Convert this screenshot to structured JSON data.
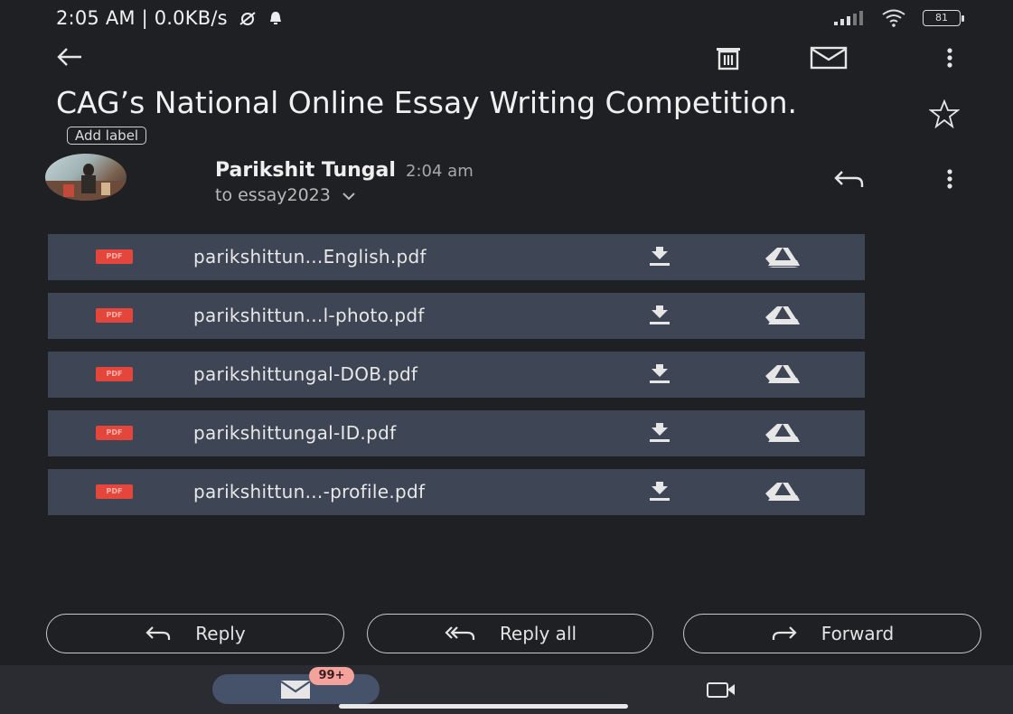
{
  "status_bar": {
    "left_text": "2:05 AM | 0.0KB/s",
    "battery": "81"
  },
  "email": {
    "subject": "CAG’s National Online Essay Writing Competition.",
    "add_label": "Add label",
    "sender": "Parikshit Tungal",
    "time": "2:04 am",
    "recipient": "to essay2023",
    "attachments": [
      {
        "name": "parikshittun...English.pdf",
        "badge": "PDF"
      },
      {
        "name": "parikshittun...l-photo.pdf",
        "badge": "PDF"
      },
      {
        "name": "parikshittungal-DOB.pdf",
        "badge": "PDF"
      },
      {
        "name": "parikshittungal-ID.pdf",
        "badge": "PDF"
      },
      {
        "name": "parikshittun...-profile.pdf",
        "badge": "PDF"
      }
    ]
  },
  "actions": {
    "reply": "Reply",
    "reply_all": "Reply all",
    "forward": "Forward"
  },
  "bottom_nav": {
    "mail_badge": "99+"
  },
  "icons": {
    "back": "back-arrow-icon",
    "delete": "trash-icon",
    "mark_unread": "envelope-icon",
    "more": "more-vert-icon",
    "star": "star-icon",
    "reply": "reply-icon",
    "download": "download-icon",
    "drive": "drive-icon",
    "meet": "video-icon"
  },
  "colors": {
    "background": "#1f2023",
    "attachment_bg": "#3e4554",
    "pdf_red": "#e5463b",
    "badge": "#f4a39c",
    "nav_pill": "#46516a"
  }
}
